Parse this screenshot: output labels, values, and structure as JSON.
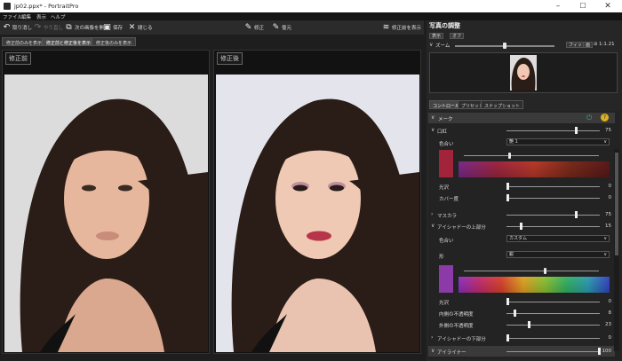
{
  "window": {
    "title": "jp02.ppx* - PortraitPro",
    "min": "–",
    "max": "☐",
    "close": "✕"
  },
  "menu": [
    "ファイル",
    "編集",
    "表示",
    "ヘルプ"
  ],
  "toolbar": {
    "undo": "取り消し",
    "redo": "やり直し",
    "open_next": "次の画像を開く",
    "save": "保存",
    "close": "閉じる",
    "correct": "修正",
    "restore": "復元",
    "before_after": "修正前を表示"
  },
  "view_tabs": [
    "修正前のみを表示",
    "修正前と修正後を表示",
    "修正後のみを表示"
  ],
  "panes": {
    "before_label": "修正前",
    "after_label": "修正後"
  },
  "right": {
    "title": "写真の調整",
    "display_btn": "表示",
    "off_btn": "オフ",
    "zoom_label": "ズーム",
    "zoom_level": 0.5,
    "fit_btn": "フィット",
    "full_btn": "画",
    "ratio": "1:1.21",
    "tabs": [
      "コントロール",
      "プリセット",
      "スナップショット"
    ],
    "makeup_label": "メーク",
    "lipstick": {
      "label": "口紅",
      "value": "75",
      "level": 0.75
    },
    "color_label": "色合い",
    "color_value": "艶 1",
    "gloss": {
      "label": "光沢",
      "value": "0",
      "level": 0.0
    },
    "coverage": {
      "label": "カバー度",
      "value": "0",
      "level": 0.0
    },
    "mascara": {
      "label": "マスカラ",
      "value": "75",
      "level": 0.75
    },
    "upper_eyeshadow": {
      "label": "アイシャドーの上部分",
      "value": "15",
      "level": 0.15
    },
    "eyeshadow_color_label": "色合い",
    "eyeshadow_color_value": "カスタム",
    "shape_label": "形",
    "shape_value": "鋭",
    "gloss2": {
      "label": "光沢",
      "value": "0",
      "level": 0.0
    },
    "inner_opacity": {
      "label": "内側の不透明度",
      "value": "8",
      "level": 0.08
    },
    "outer_opacity": {
      "label": "外側の不透明度",
      "value": "23",
      "level": 0.23
    },
    "lower_eyeshadow": {
      "label": "アイシャドーの下部分",
      "value": "0",
      "level": 0.0
    },
    "eyeliner": {
      "label": "アイライナー",
      "value": "100",
      "level": 1.0
    }
  },
  "colors": {
    "lip_swatch": "#a2243a",
    "shadow_swatch": "#8b3aa8",
    "power_icon": "#3bb36c",
    "help_icon": "#e0b020"
  }
}
